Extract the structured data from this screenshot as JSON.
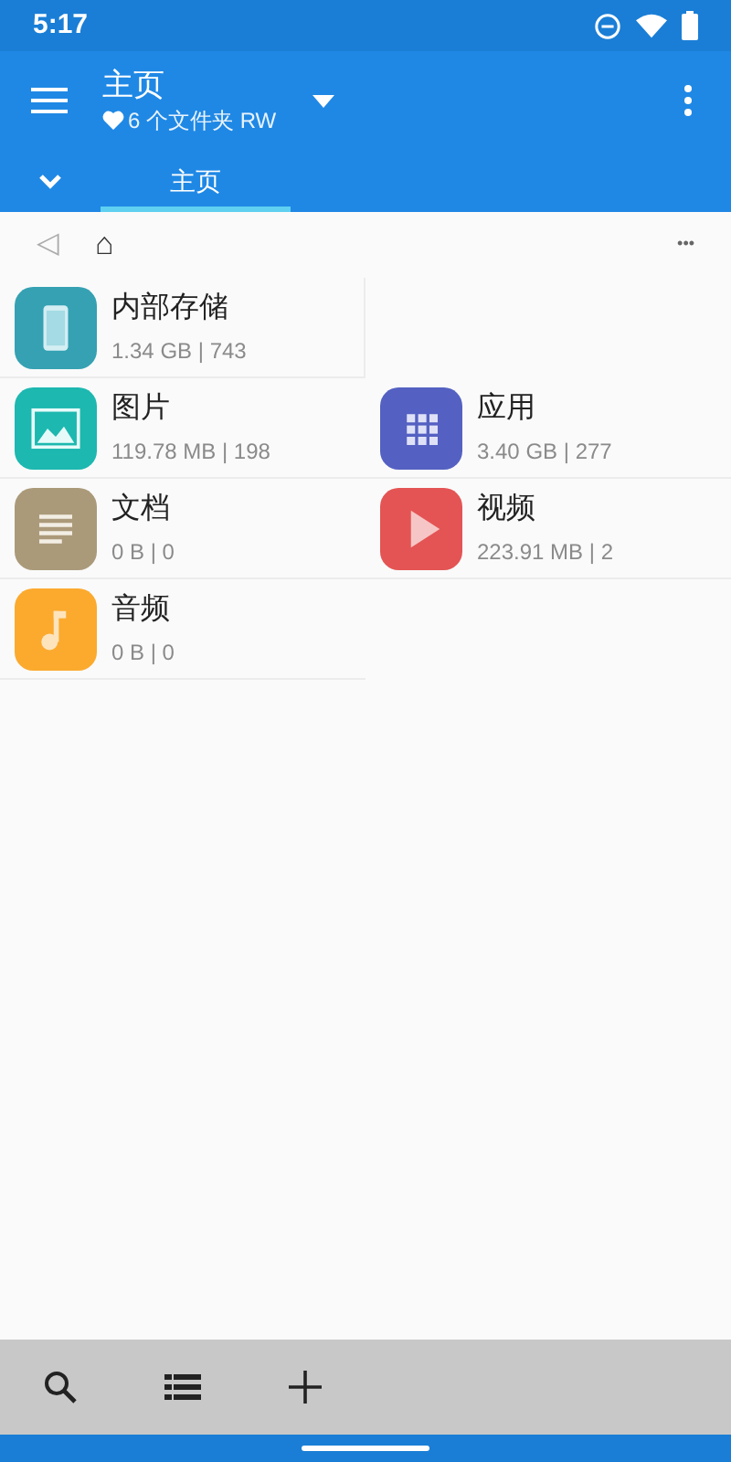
{
  "status_bar": {
    "time": "5:17"
  },
  "app_bar": {
    "title": "主页",
    "subtitle": "6 个文件夹 RW"
  },
  "tabs": [
    {
      "label": "主页",
      "selected": true
    }
  ],
  "breadcrumb": {
    "back_glyph": "◁",
    "home_glyph": "⌂",
    "more_glyph": "•••"
  },
  "rows": [
    [
      {
        "kind": "phone",
        "name": "内部存储",
        "info": "1.34 GB | 743",
        "color": "#35a1b3"
      }
    ],
    [
      {
        "kind": "image",
        "name": "图片",
        "info": "119.78 MB | 198",
        "color": "#1db8b0"
      },
      {
        "kind": "apps",
        "name": "应用",
        "info": "3.40 GB | 277",
        "color": "#5461c2"
      }
    ],
    [
      {
        "kind": "doc",
        "name": "文档",
        "info": "0 B | 0",
        "color": "#ab9a7a"
      },
      {
        "kind": "video",
        "name": "视频",
        "info": "223.91 MB | 2",
        "color": "#e45454"
      }
    ],
    [
      {
        "kind": "music",
        "name": "音频",
        "info": "0 B | 0",
        "color": "#fbaa2e"
      }
    ]
  ],
  "toolbar": [
    {
      "kind": "search"
    },
    {
      "kind": "list"
    },
    {
      "kind": "add"
    }
  ]
}
